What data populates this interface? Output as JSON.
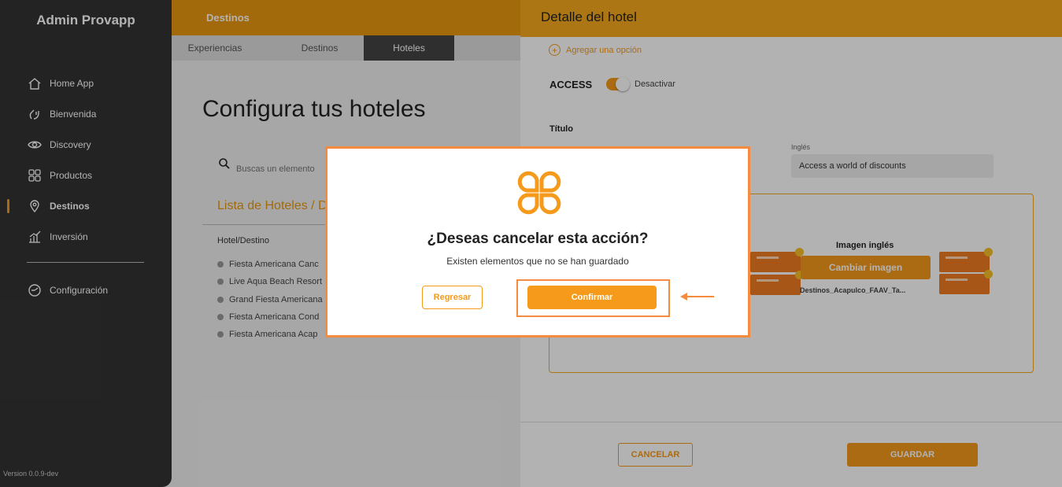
{
  "sidebar": {
    "brand": "Admin Provapp",
    "items": [
      {
        "label": "Home App",
        "icon": "home-icon"
      },
      {
        "label": "Bienvenida",
        "icon": "hand-wave-icon"
      },
      {
        "label": "Discovery",
        "icon": "eye-icon"
      },
      {
        "label": "Productos",
        "icon": "grid-icon"
      },
      {
        "label": "Destinos",
        "icon": "map-pin-icon",
        "active": true
      },
      {
        "label": "Inversión",
        "icon": "chart-icon"
      },
      {
        "label": "Configuración",
        "icon": "settings-icon"
      }
    ],
    "version": "Version 0.0.9-dev"
  },
  "header": {
    "title": "Destinos"
  },
  "tabs": [
    {
      "label": "Experiencias"
    },
    {
      "label": "Destinos"
    },
    {
      "label": "Hoteles",
      "active": true
    }
  ],
  "main": {
    "title": "Configura tus hoteles",
    "search_placeholder": "Buscas un elemento",
    "list_title": "Lista de Hoteles / D",
    "column_header": "Hotel/Destino",
    "hotels": [
      "Fiesta Americana Canc",
      "Live Aqua Beach Resort",
      "Grand Fiesta Americana",
      "Fiesta Americana Cond",
      "Fiesta Americana Acap"
    ]
  },
  "drawer": {
    "title": "Detalle del hotel",
    "add_option": "Agregar una opción",
    "access_label": "ACCESS",
    "toggle_label": "Desactivar",
    "toggle_on": true,
    "titulo_label": "Título",
    "ingles_label": "Inglés",
    "ingles_value": "Access a world of discounts",
    "image_ingles_title": "Imagen inglés",
    "change_image": "Cambiar imagen",
    "image_filename": "Destinos_Acapulco_FAAV_Ta...",
    "cancel": "CANCELAR",
    "save": "GUARDAR"
  },
  "modal": {
    "title": "¿Deseas cancelar esta acción?",
    "subtitle": "Existen elementos que no se han guardado",
    "back": "Regresar",
    "confirm": "Confirmar"
  },
  "colors": {
    "accent": "#f59a1b",
    "header": "#e8980f",
    "highlight": "#f58b3e",
    "sidebar": "#333333"
  }
}
